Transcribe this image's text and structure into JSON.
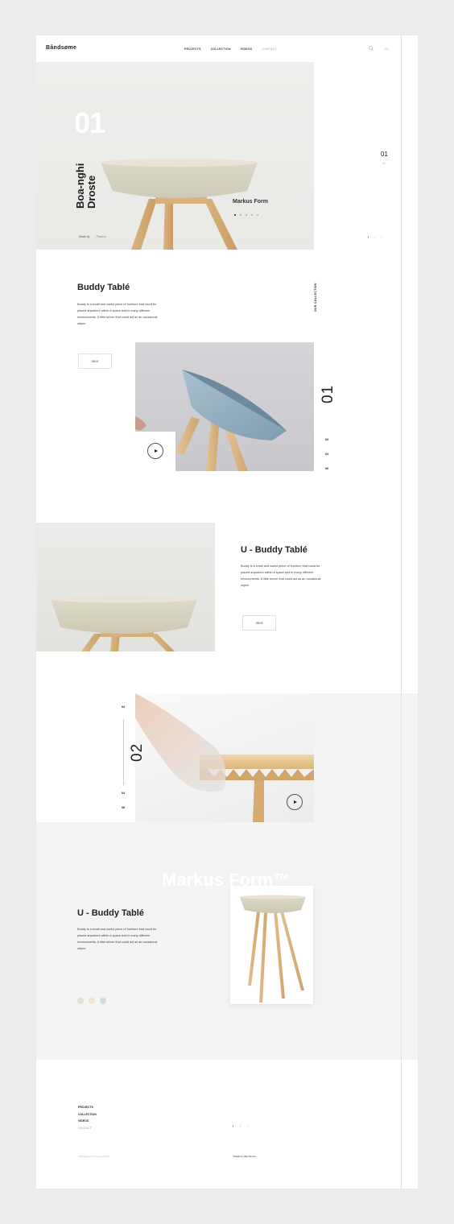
{
  "brand": {
    "logo": "Båndsøme"
  },
  "nav": {
    "items": [
      "PROJECTS",
      "COLLECTION",
      "VIDEOS",
      "CONTACT"
    ],
    "lang": "EN"
  },
  "hero": {
    "number": "01",
    "title_line1": "Boa-nghi",
    "title_line2": "Droste",
    "designer": "Markus Form",
    "made_by_label": "Made by",
    "made_by_value": "Passion",
    "slide_current": "01",
    "slide_next": "02"
  },
  "social": {
    "facebook": "f",
    "twitter": "t",
    "other": "i"
  },
  "section1": {
    "title": "Buddy Tablé",
    "description": "Buddy is a small and useful piece of furniture that could be placed anywhere within a space and in many different environments. A little server that could act as an occasional object",
    "collection_label": "OUR COLLECTION",
    "price": "250 €",
    "big_number": "01",
    "list": [
      "02",
      "04",
      "06"
    ]
  },
  "section2": {
    "title": "U - Buddy Tablé",
    "description": "Buddy is a small and useful piece of furniture that could be placed anywhere within a space and in many different environments. A little server that could act as an occasional object",
    "price": "250 €"
  },
  "section3": {
    "big_number": "02",
    "list_top": "02",
    "list_bottom": [
      "04",
      "06"
    ]
  },
  "section4": {
    "watermark": "Markus Form™",
    "title": "U - Buddy Tablé",
    "description": "Buddy is a small and useful piece of furniture that could be placed anywhere within a space and in many different environments. A little server that could act as an occasional object",
    "swatches": [
      "#e6e2d8",
      "#ebe7cf",
      "#cfdce8"
    ]
  },
  "footer": {
    "links": [
      "PROJECTS",
      "COLLECTION",
      "VIDEOS",
      "CONTACT"
    ],
    "copyright": "All Rights are Reserved 2016",
    "made_by": "©Made by Bandsome"
  }
}
